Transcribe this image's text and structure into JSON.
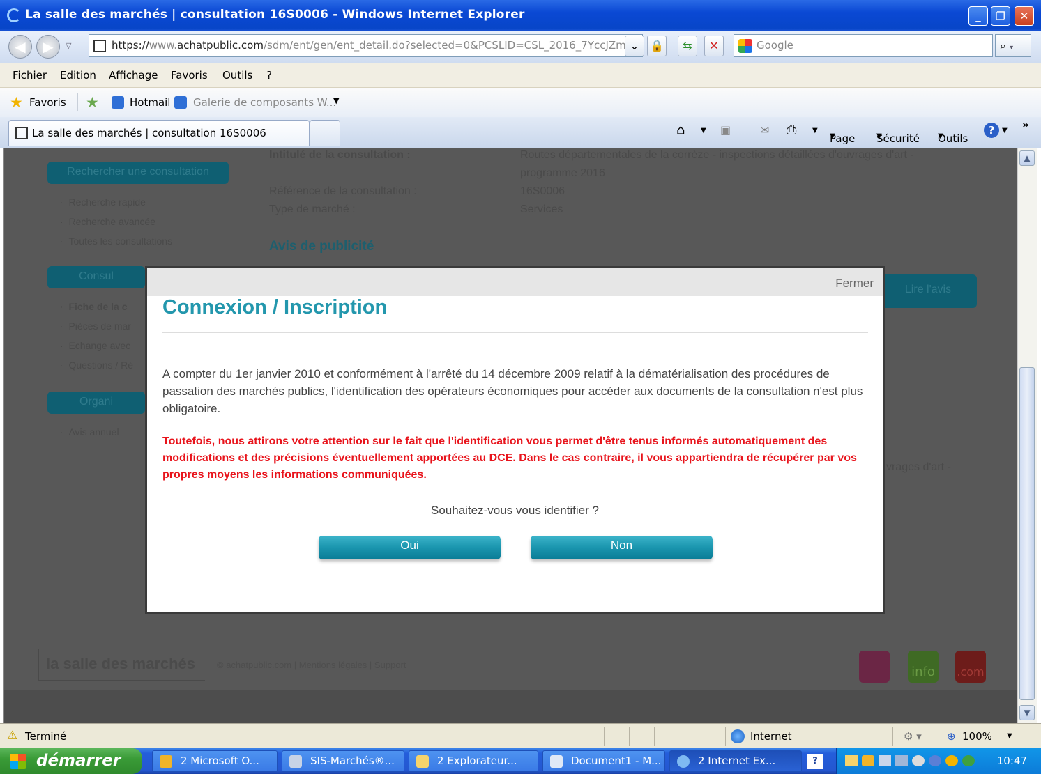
{
  "window": {
    "title": "La salle des marchés | consultation 16S0006 - Windows Internet Explorer",
    "controls": [
      "minimize-icon",
      "restore-icon",
      "close-icon"
    ]
  },
  "address_bar": {
    "url_scheme": "https://",
    "url_host_prefix": "www.",
    "url_host": "achatpublic.com",
    "url_path": "/sdm/ent/gen/ent_detail.do?selected=0&PCSLID=CSL_2016_7YccJZm_36",
    "search_placeholder": "Google"
  },
  "menu": [
    "Fichier",
    "Edition",
    "Affichage",
    "Favoris",
    "Outils",
    "?"
  ],
  "favorites_bar": {
    "favorites_label": "Favoris",
    "hotmail": "Hotmail",
    "gallery": "Galerie de composants W..."
  },
  "tab": {
    "title": "La salle des marchés | consultation 16S0006"
  },
  "command_bar": {
    "page": "Page",
    "security": "Sécurité",
    "tools": "Outils"
  },
  "page": {
    "sidebar": {
      "search_button": "Rechercher une consultation",
      "search_items": [
        "Recherche rapide",
        "Recherche avancée",
        "Toutes les consultations"
      ],
      "consult_button": "Consul",
      "consult_items": [
        "Fiche de la c",
        "Pièces de mar",
        "Echange avec",
        "Questions / Ré"
      ],
      "org_button": "Organi",
      "org_items": [
        "Avis annuel"
      ]
    },
    "details": {
      "intitule_label": "Intitulé de la consultation :",
      "intitule_value_1": "Routes départementales de la corrèze - inspections détaillées d'ouvrages d'art -",
      "intitule_value_2": "programme 2016",
      "reference_label": "Référence de la consultation :",
      "reference_value": "16S0006",
      "type_label": "Type de marché :",
      "type_value": "Services",
      "avis_heading": "Avis de publicité",
      "lire_avis": "Lire l'avis",
      "fragment_right": "vrages d'art -"
    },
    "footer": {
      "logo": "la salle des marchés",
      "copyright": "© achatpublic.com",
      "legal": "Mentions légales",
      "support": "Support",
      "badge_info": "info",
      "badge_com": ".com"
    }
  },
  "modal": {
    "close_label": "Fermer",
    "title": "Connexion / Inscription",
    "paragraph_1": "A compter du 1er janvier 2010 et conformément à l'arrêté du 14 décembre 2009 relatif à la dématérialisation des procédures de passation des marchés publics, l'identification des opérateurs économiques pour accéder aux documents de la consultation n'est plus obligatoire.",
    "paragraph_2": "Toutefois, nous attirons votre attention sur le fait que l'identification vous permet d'être tenus informés automatiquement des modifications et des précisions éventuellement apportées au DCE. Dans le cas contraire, il vous appartiendra de récupérer par vos propres moyens les informations communiquées.",
    "question": "Souhaitez-vous vous identifier ?",
    "yes": "Oui",
    "no": "Non",
    "colors": {
      "title": "#2397ad",
      "warning": "#e8141c",
      "button": "#1a95ae"
    }
  },
  "status_bar": {
    "status": "Terminé",
    "zone": "Internet",
    "zoom": "100%"
  },
  "taskbar": {
    "start": "démarrer",
    "tasks": [
      "2 Microsoft O...",
      "SIS-Marchés®...",
      "2 Explorateur...",
      "Document1 - M...",
      "2 Internet Ex..."
    ],
    "clock": "10:47"
  }
}
